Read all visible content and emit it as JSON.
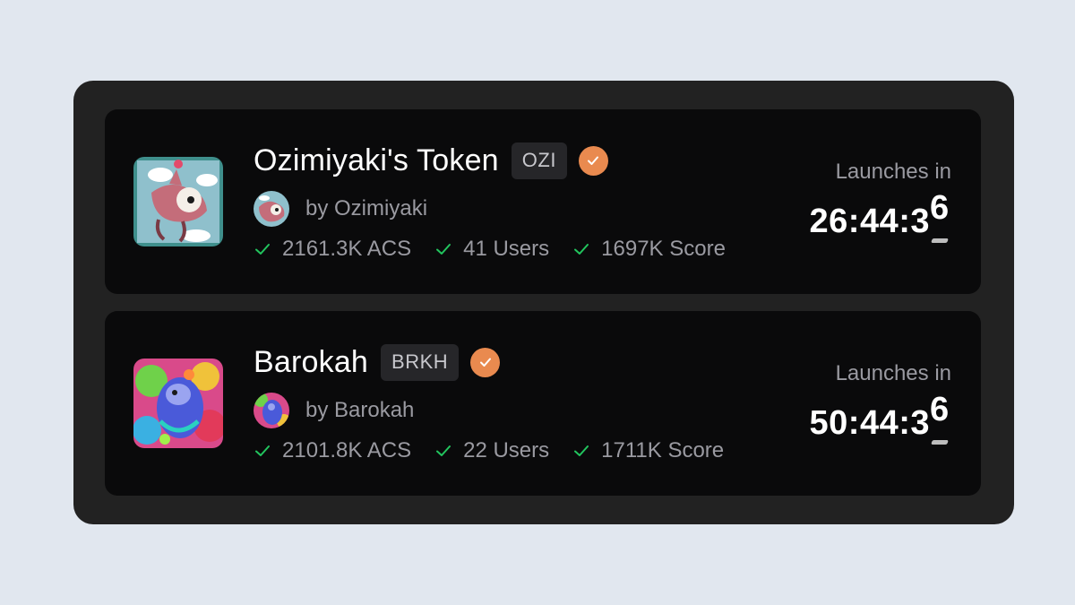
{
  "tokens": [
    {
      "name": "Ozimiyaki's Token",
      "ticker": "OZI",
      "creator": "by Ozimiyaki",
      "stats": [
        "2161.3K ACS",
        "41 Users",
        "1697K Score"
      ],
      "launch_label": "Launches in",
      "countdown": "26:44:3",
      "countdown_last_digit": "6",
      "thumb_icon": "cartoon-pig-artwork-icon"
    },
    {
      "name": "Barokah",
      "ticker": "BRKH",
      "creator": "by Barokah",
      "stats": [
        "2101.8K ACS",
        "22 Users",
        "1711K Score"
      ],
      "launch_label": "Launches in",
      "countdown": "50:44:3",
      "countdown_last_digit": "6",
      "thumb_icon": "psychedelic-artwork-icon"
    }
  ],
  "colors": {
    "page_bg": "#e1e7ef",
    "panel_bg": "#222222",
    "card_bg": "#0a0a0b",
    "verified": "#e98a4f",
    "check": "#22c55e",
    "muted_text": "#9a9aa1"
  }
}
